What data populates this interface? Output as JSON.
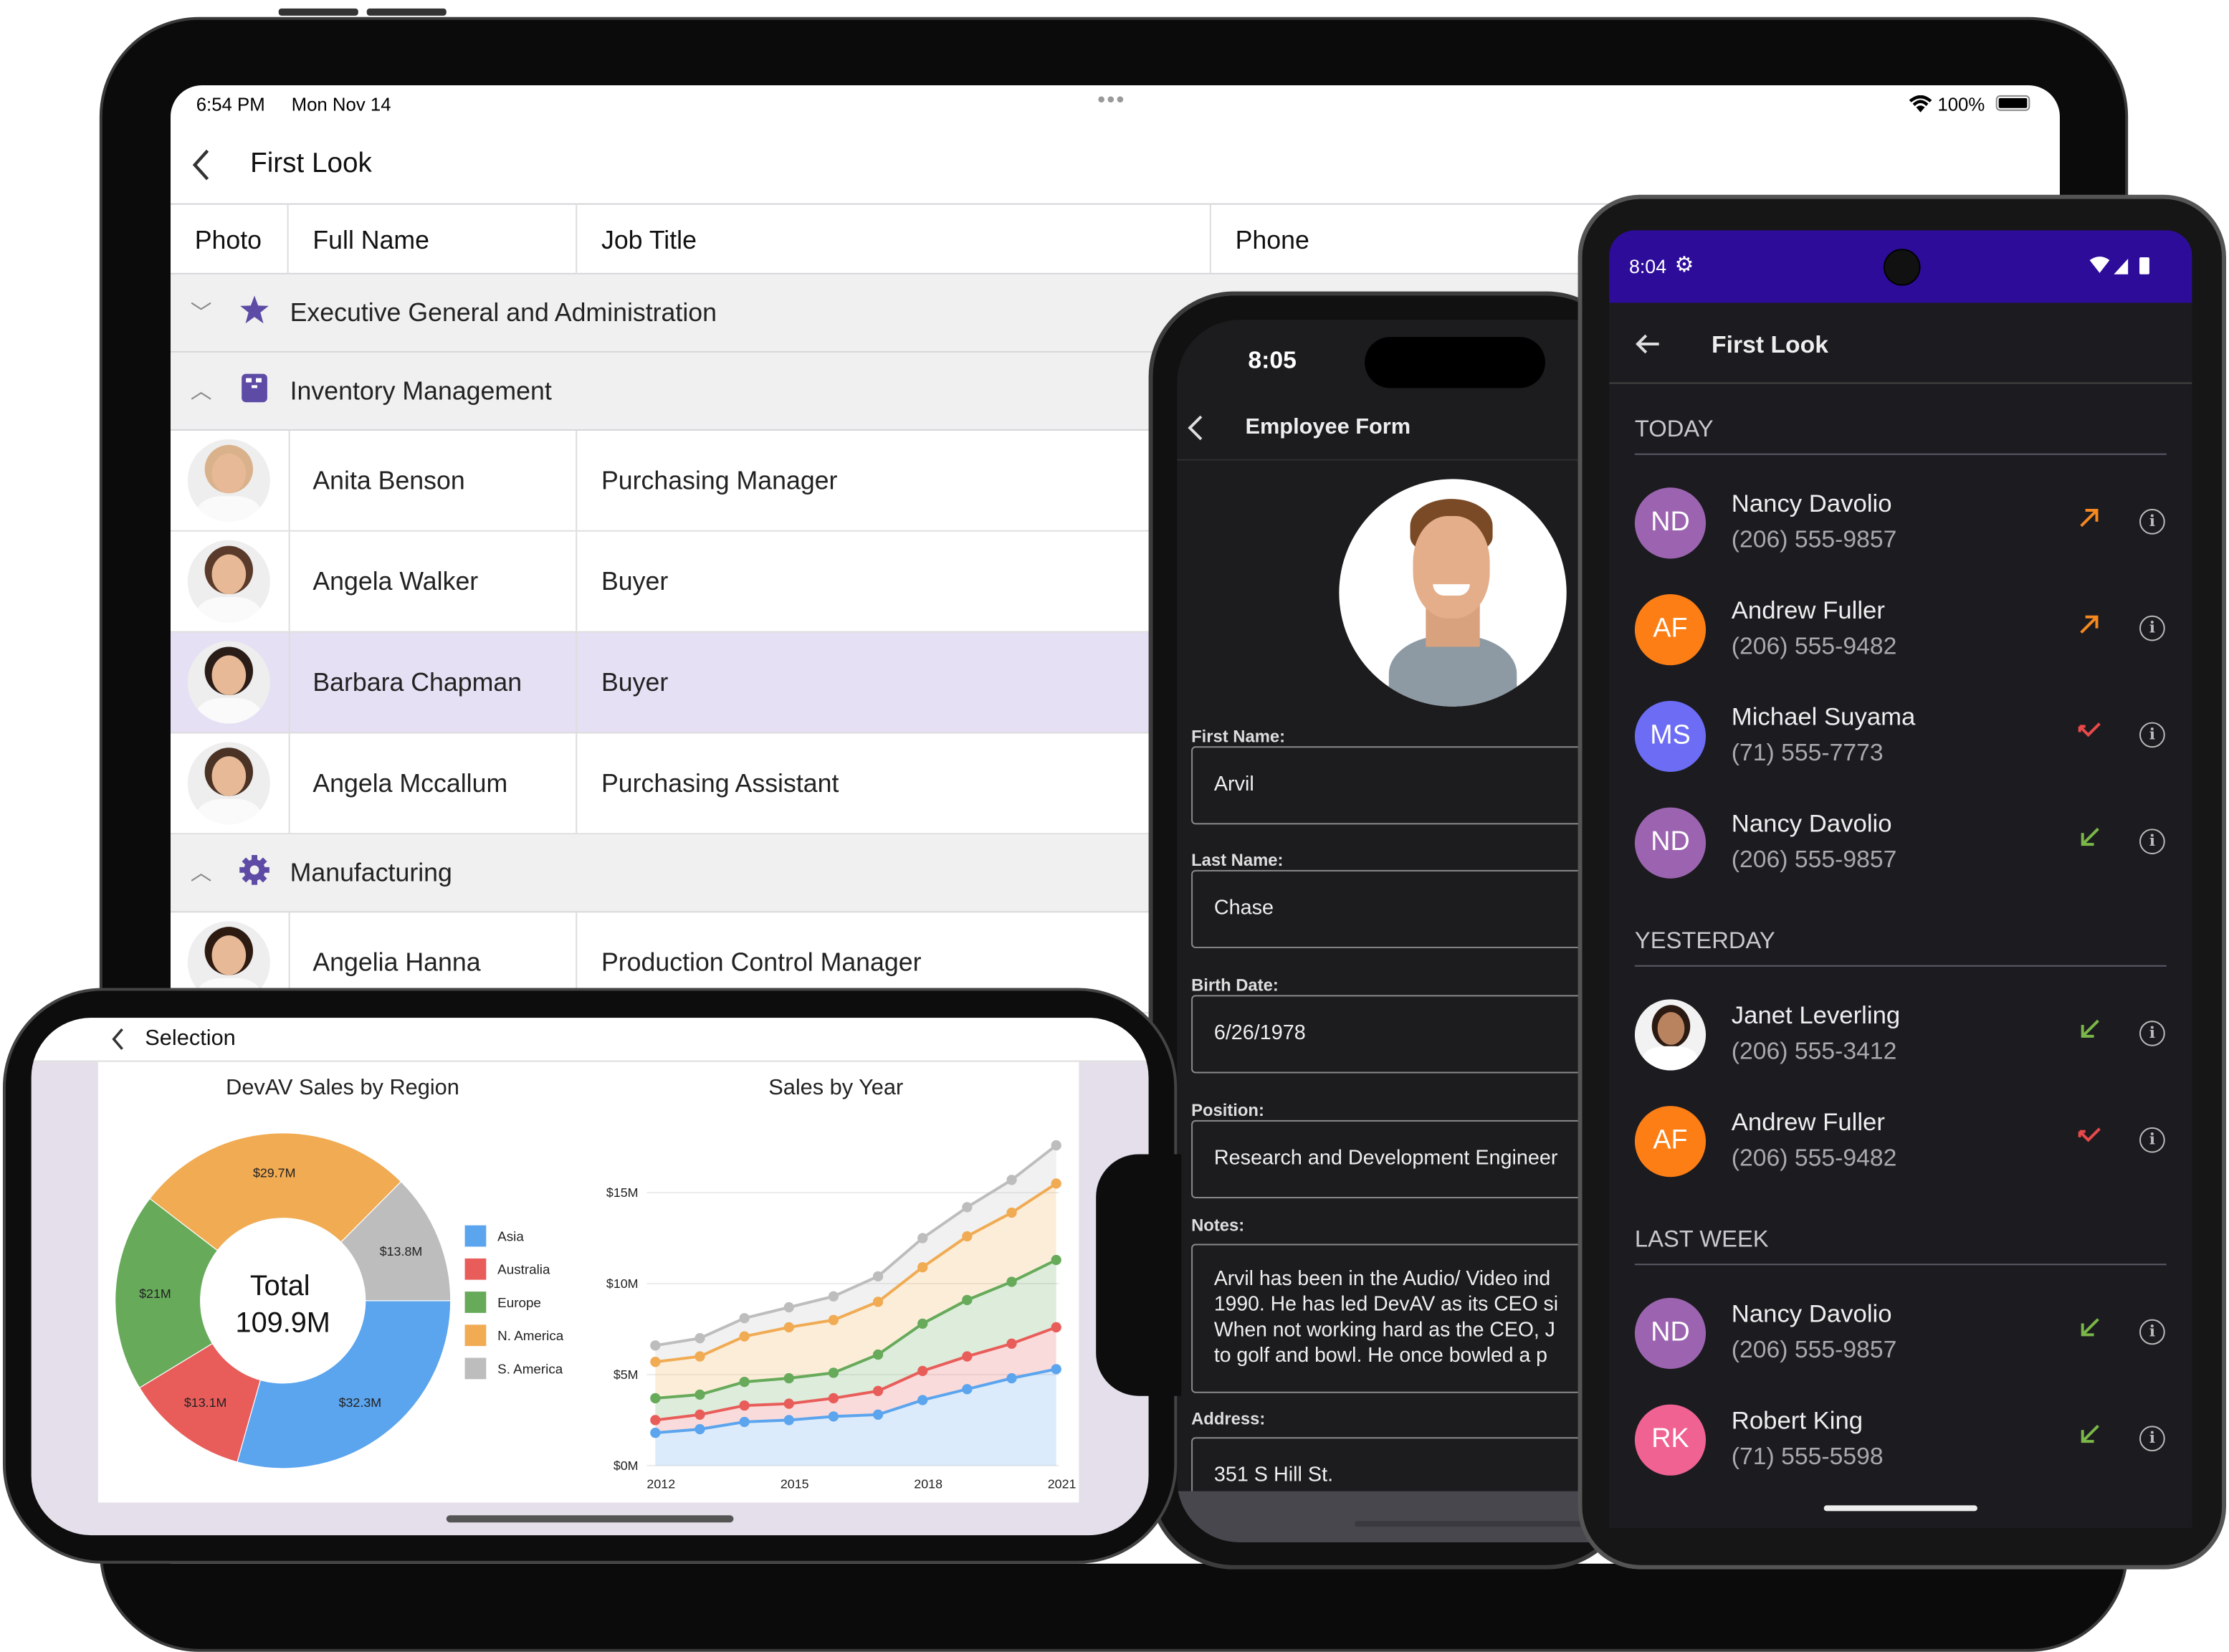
{
  "ipad": {
    "status": {
      "time": "6:54 PM",
      "date": "Mon Nov 14",
      "battery": "100%"
    },
    "nav_title": "First Look",
    "columns": [
      "Photo",
      "Full Name",
      "Job Title",
      "Phone"
    ],
    "groups": [
      {
        "label": "Executive General and Administration",
        "icon": "star-icon",
        "expanded": false
      },
      {
        "label": "Inventory Management",
        "icon": "archive-icon",
        "expanded": true
      },
      {
        "label": "Manufacturing",
        "icon": "gear-icon",
        "expanded": true
      }
    ],
    "inventory_rows": [
      {
        "name": "Anita Benson",
        "title": "Purchasing Manager",
        "selected": false
      },
      {
        "name": "Angela Walker",
        "title": "Buyer",
        "selected": false
      },
      {
        "name": "Barbara Chapman",
        "title": "Buyer",
        "selected": true
      },
      {
        "name": "Angela Mccallum",
        "title": "Purchasing Assistant",
        "selected": false
      }
    ],
    "manufacturing_rows": [
      {
        "name": "Angelia Hanna",
        "title": "Production Control Manager",
        "selected": false
      }
    ],
    "accent": "#5e4ba5",
    "selected_row_color": "#e6e0f4"
  },
  "landscape_phone": {
    "nav_title": "Selection"
  },
  "chart_data": [
    {
      "type": "pie",
      "title": "DevAV Sales by Region",
      "donut": true,
      "center_label": [
        "Total",
        "109.9M"
      ],
      "categories": [
        "Asia",
        "Australia",
        "Europe",
        "N. America",
        "S. America"
      ],
      "values": [
        32.3,
        13.1,
        21,
        29.7,
        13.8
      ],
      "labels": [
        "$32.3M",
        "$13.1M",
        "$21M",
        "$29.7M",
        "$13.8M"
      ],
      "colors": [
        "#5ba4ee",
        "#e85d5a",
        "#66aa5a",
        "#f0ab53",
        "#bdbdbd"
      ],
      "legend": "right"
    },
    {
      "type": "area",
      "stacked": true,
      "title": "Sales by Year",
      "x": [
        2012,
        2013,
        2014,
        2015,
        2016,
        2017,
        2018,
        2019,
        2020,
        2021
      ],
      "xticks": [
        "2012",
        "2015",
        "2018",
        "2021"
      ],
      "yticks": [
        "$0M",
        "$5M",
        "$10M",
        "$15M"
      ],
      "ylim": [
        0,
        18
      ],
      "grid": true,
      "series": [
        {
          "name": "Asia",
          "color": "#5ba4ee",
          "values": [
            1.8,
            2.0,
            2.4,
            2.5,
            2.7,
            2.8,
            3.6,
            4.2,
            4.8,
            5.3
          ]
        },
        {
          "name": "Australia",
          "color": "#e85d5a",
          "values": [
            0.7,
            0.8,
            0.9,
            0.9,
            1.0,
            1.3,
            1.6,
            1.8,
            1.9,
            2.3
          ]
        },
        {
          "name": "Europe",
          "color": "#66aa5a",
          "values": [
            1.2,
            1.1,
            1.3,
            1.4,
            1.4,
            2.0,
            2.6,
            3.1,
            3.4,
            3.7
          ]
        },
        {
          "name": "N. America",
          "color": "#f0ab53",
          "values": [
            2.0,
            2.1,
            2.5,
            2.8,
            2.9,
            2.9,
            3.1,
            3.5,
            3.8,
            4.2
          ]
        },
        {
          "name": "S. America",
          "color": "#bdbdbd",
          "values": [
            0.9,
            1.0,
            1.0,
            1.1,
            1.3,
            1.4,
            1.6,
            1.6,
            1.8,
            2.1
          ]
        }
      ]
    }
  ],
  "portrait_phone": {
    "time": "8:05",
    "nav_title": "Employee Form",
    "fields": [
      {
        "label": "First Name:",
        "value": "Arvil"
      },
      {
        "label": "Last Name:",
        "value": "Chase"
      },
      {
        "label": "Birth Date:",
        "value": "6/26/1978"
      },
      {
        "label": "Position:",
        "value": "Research and Development Engineer"
      }
    ],
    "notes_label": "Notes:",
    "notes_lines": [
      "Arvil has been in the Audio/ Video ind",
      "1990. He has led DevAV as its CEO si",
      "When not working hard as the CEO, J",
      "to golf and bowl. He once bowled a p"
    ],
    "address_label": "Address:",
    "address_value": "351 S Hill St."
  },
  "android": {
    "time": "8:04",
    "nav_title": "First Look",
    "status_bar_color": "#2d0c9a",
    "sections": [
      {
        "title": "TODAY",
        "items": [
          {
            "initials": "ND",
            "name": "Nancy Davolio",
            "phone": "(206) 555-9857",
            "color": "#9c64b0",
            "call": "outgoing"
          },
          {
            "initials": "AF",
            "name": "Andrew Fuller",
            "phone": "(206) 555-9482",
            "color": "#fd7e14",
            "call": "outgoing"
          },
          {
            "initials": "MS",
            "name": "Michael Suyama",
            "phone": "(71) 555-7773",
            "color": "#6c6cf5",
            "call": "missed"
          },
          {
            "initials": "ND",
            "name": "Nancy Davolio",
            "phone": "(206) 555-9857",
            "color": "#9c64b0",
            "call": "incoming"
          }
        ]
      },
      {
        "title": "YESTERDAY",
        "items": [
          {
            "initials": "",
            "name": "Janet Leverling",
            "phone": "(206) 555-3412",
            "color": "#f2f2f2",
            "call": "incoming",
            "photo": true
          },
          {
            "initials": "AF",
            "name": "Andrew Fuller",
            "phone": "(206) 555-9482",
            "color": "#fd7e14",
            "call": "missed"
          }
        ]
      },
      {
        "title": "LAST WEEK",
        "items": [
          {
            "initials": "ND",
            "name": "Nancy Davolio",
            "phone": "(206) 555-9857",
            "color": "#9c64b0",
            "call": "incoming"
          },
          {
            "initials": "RK",
            "name": "Robert King",
            "phone": "(71) 555-5598",
            "color": "#f06292",
            "call": "incoming"
          }
        ]
      }
    ],
    "call_colors": {
      "outgoing": "#f5891f",
      "missed": "#e84a4a",
      "incoming": "#7ab648"
    }
  }
}
